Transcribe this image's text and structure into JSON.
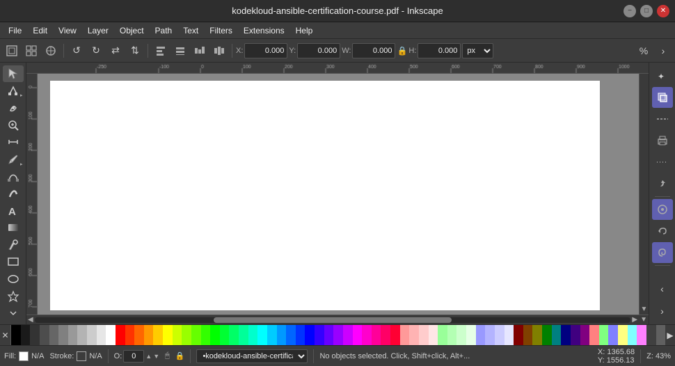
{
  "titlebar": {
    "title": "kodekloud-ansible-certification-course.pdf - Inkscape"
  },
  "menubar": {
    "items": [
      "File",
      "Edit",
      "View",
      "Layer",
      "Object",
      "Path",
      "Text",
      "Filters",
      "Extensions",
      "Help"
    ]
  },
  "toolbar": {
    "x_label": "X:",
    "x_value": "0.000",
    "y_label": "Y:",
    "y_value": "0.000",
    "w_label": "W:",
    "w_value": "0.000",
    "h_label": "H:",
    "h_value": "0.000",
    "unit": "px"
  },
  "left_tools": [
    {
      "name": "select-tool",
      "icon": "↖",
      "label": "Select"
    },
    {
      "name": "node-tool",
      "icon": "◈",
      "label": "Node"
    },
    {
      "name": "tweak-tool",
      "icon": "〜",
      "label": "Tweak"
    },
    {
      "name": "zoom-tool",
      "icon": "🔍",
      "label": "Zoom"
    },
    {
      "name": "measure-tool",
      "icon": "📏",
      "label": "Measure"
    },
    {
      "name": "pencil-tool",
      "icon": "✏",
      "label": "Pencil"
    },
    {
      "name": "pen-tool",
      "icon": "🖊",
      "label": "Pen"
    },
    {
      "name": "calligraphy-tool",
      "icon": "✒",
      "label": "Calligraphy"
    },
    {
      "name": "text-tool",
      "icon": "A",
      "label": "Text"
    },
    {
      "name": "gradient-tool",
      "icon": "▣",
      "label": "Gradient"
    },
    {
      "name": "dropper-tool",
      "icon": "💧",
      "label": "Dropper"
    },
    {
      "name": "rect-tool",
      "icon": "□",
      "label": "Rectangle"
    },
    {
      "name": "ellipse-tool",
      "icon": "○",
      "label": "Ellipse"
    },
    {
      "name": "star-tool",
      "icon": "★",
      "label": "Star"
    },
    {
      "name": "expand-tool",
      "icon": "›",
      "label": "More"
    }
  ],
  "right_panel": [
    {
      "name": "xml-editor",
      "icon": "✦",
      "label": "XML"
    },
    {
      "name": "fill-stroke",
      "icon": "◈",
      "label": "Fill/Stroke",
      "active": true
    },
    {
      "name": "dashes1",
      "icon": "---",
      "label": "Dashes"
    },
    {
      "name": "print",
      "icon": "🖨",
      "label": "Print"
    },
    {
      "name": "dashes2",
      "icon": "---",
      "label": "Dashes2"
    },
    {
      "name": "rotate-cw",
      "icon": "↩",
      "label": "Undo"
    },
    {
      "name": "active-btn",
      "icon": "◉",
      "label": "Active",
      "active": true
    },
    {
      "name": "rotate-ccw",
      "icon": "↪",
      "label": "Redo"
    },
    {
      "name": "spiral",
      "icon": "⤾",
      "label": "Spiral",
      "active": true
    }
  ],
  "palette": {
    "colors": [
      "#000000",
      "#1a1a1a",
      "#333333",
      "#4d4d4d",
      "#666666",
      "#808080",
      "#999999",
      "#b3b3b3",
      "#cccccc",
      "#e6e6e6",
      "#ffffff",
      "#ff0000",
      "#ff3300",
      "#ff6600",
      "#ff9900",
      "#ffcc00",
      "#ffff00",
      "#ccff00",
      "#99ff00",
      "#66ff00",
      "#33ff00",
      "#00ff00",
      "#00ff33",
      "#00ff66",
      "#00ff99",
      "#00ffcc",
      "#00ffff",
      "#00ccff",
      "#0099ff",
      "#0066ff",
      "#0033ff",
      "#0000ff",
      "#3300ff",
      "#6600ff",
      "#9900ff",
      "#cc00ff",
      "#ff00ff",
      "#ff00cc",
      "#ff0099",
      "#ff0066",
      "#ff0033",
      "#ff9999",
      "#ffb3b3",
      "#ffcccc",
      "#ffe6e6",
      "#99ff99",
      "#b3ffb3",
      "#ccffcc",
      "#e6ffe6",
      "#9999ff",
      "#b3b3ff",
      "#ccccff",
      "#e6e6ff",
      "#800000",
      "#804000",
      "#808000",
      "#008000",
      "#008080",
      "#000080",
      "#400080",
      "#800080",
      "#ff8080",
      "#80ff80",
      "#8080ff",
      "#ffff80",
      "#80ffff",
      "#ff80ff",
      "#404040",
      "#606060"
    ]
  },
  "statusbar": {
    "fill_label": "Fill:",
    "fill_value": "N/A",
    "stroke_label": "Stroke:",
    "stroke_value": "N/A",
    "opacity_label": "O:",
    "opacity_value": "0",
    "layer_value": "•kodekloud-ansible-certification-course",
    "status_message": "No objects selected. Click, Shift+click, Alt+...",
    "coords": "X: 1365.68\nY: 1556.13",
    "zoom": "43°"
  }
}
